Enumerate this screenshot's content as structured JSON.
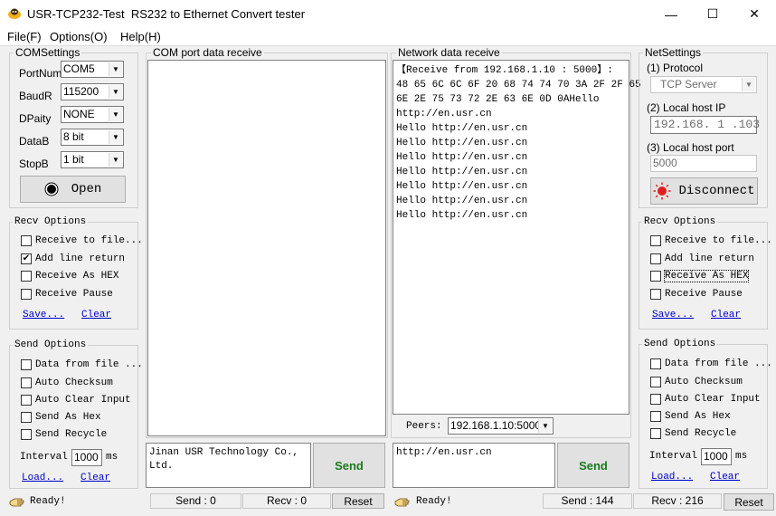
{
  "window": {
    "title": "USR-TCP232-Test  RS232 to Ethernet Convert tester",
    "minimize": "—",
    "maximize": "☐",
    "close": "✕"
  },
  "menu": [
    "File(F)",
    "Options(O)",
    "Help(H)"
  ],
  "com": {
    "title": "COMSettings",
    "fields": [
      {
        "label": "PortNum",
        "value": "COM5"
      },
      {
        "label": "BaudR",
        "value": "115200"
      },
      {
        "label": "DPaity",
        "value": "NONE"
      },
      {
        "label": "DataB",
        "value": "8 bit"
      },
      {
        "label": "StopB",
        "value": "1 bit"
      }
    ],
    "open_label": "Open"
  },
  "left_recv": {
    "title": "Recv Options",
    "items": [
      {
        "label": "Receive to file...",
        "checked": false
      },
      {
        "label": "Add line return",
        "checked": true
      },
      {
        "label": "Receive As HEX",
        "checked": false
      },
      {
        "label": "Receive Pause",
        "checked": false
      }
    ],
    "save": "Save...",
    "clear": "Clear"
  },
  "left_send": {
    "title": "Send Options",
    "items": [
      {
        "label": "Data from file ...",
        "checked": false
      },
      {
        "label": "Auto Checksum",
        "checked": false
      },
      {
        "label": "Auto Clear Input",
        "checked": false
      },
      {
        "label": "Send As Hex",
        "checked": false
      },
      {
        "label": "Send Recycle",
        "checked": false
      }
    ],
    "interval_label": "Interval",
    "interval_value": "1000",
    "interval_unit": "ms",
    "load": "Load...",
    "clear": "Clear"
  },
  "com_recv": {
    "title": "COM port data receive"
  },
  "com_send": {
    "text_line1": "Jinan USR Technology Co.,",
    "text_line2": "Ltd.",
    "send": "Send"
  },
  "net_recv": {
    "title": "Network data receive",
    "lines": [
      "【Receive from 192.168.1.10 : 5000】:",
      "48 65 6C 6C 6F 20 68 74 74 70 3A 2F 2F 65",
      "6E 2E 75 73 72 2E 63 6E 0D 0AHello",
      "http://en.usr.cn",
      "Hello http://en.usr.cn",
      "Hello http://en.usr.cn",
      "Hello http://en.usr.cn",
      "Hello http://en.usr.cn",
      "Hello http://en.usr.cn",
      "Hello http://en.usr.cn",
      "Hello http://en.usr.cn"
    ]
  },
  "peers": {
    "label": "Peers:",
    "value": "192.168.1.10:5000"
  },
  "net_send": {
    "text": "http://en.usr.cn",
    "send": "Send"
  },
  "net": {
    "title": "NetSettings",
    "protocol_label": "(1) Protocol",
    "protocol_value": "TCP Server",
    "ip_label": "(2) Local host IP",
    "ip_value": "192.168. 1 .103",
    "port_label": "(3) Local host port",
    "port_value": "5000",
    "disconnect": "Disconnect"
  },
  "right_recv": {
    "title": "Recv Options",
    "items": [
      {
        "label": "Receive to file...",
        "checked": false
      },
      {
        "label": "Add line return",
        "checked": false
      },
      {
        "label": "Receive As HEX",
        "checked": false
      },
      {
        "label": "Receive Pause",
        "checked": false
      }
    ],
    "save": "Save...",
    "clear": "Clear"
  },
  "right_send": {
    "title": "Send Options",
    "items": [
      {
        "label": "Data from file ...",
        "checked": false
      },
      {
        "label": "Auto Checksum",
        "checked": false
      },
      {
        "label": "Auto Clear Input",
        "checked": false
      },
      {
        "label": "Send As Hex",
        "checked": false
      },
      {
        "label": "Send Recycle",
        "checked": false
      }
    ],
    "interval_label": "Interval",
    "interval_value": "1000",
    "interval_unit": "ms",
    "load": "Load...",
    "clear": "Clear"
  },
  "status_left": {
    "ready": "Ready!",
    "send": "Send : 0",
    "recv": "Recv : 0",
    "reset": "Reset"
  },
  "status_right": {
    "ready": "Ready!",
    "send": "Send : 144",
    "recv": "Recv : 216",
    "reset": "Reset"
  },
  "colors": {
    "send_text": "#1a7a1a",
    "disconnect_dot": "#e02020"
  }
}
